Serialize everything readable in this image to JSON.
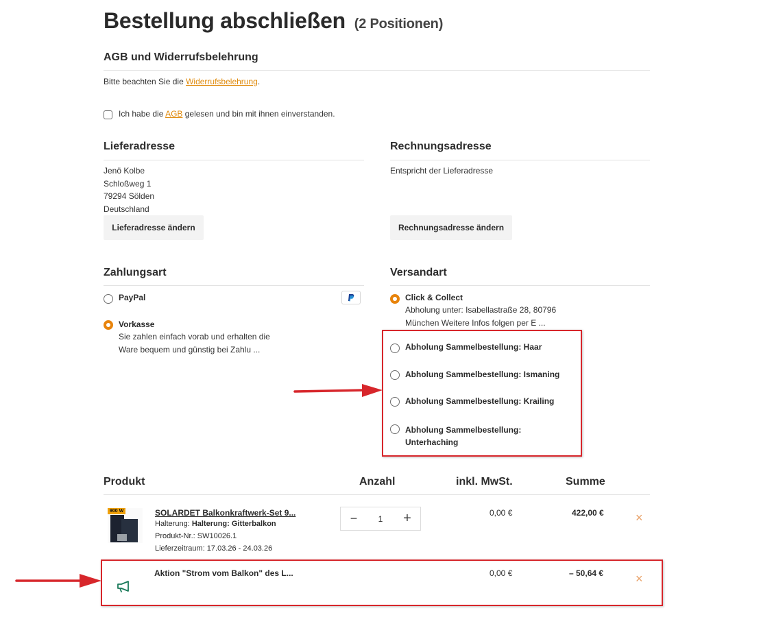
{
  "header": {
    "title": "Bestellung abschließen",
    "count": "(2 Positionen)"
  },
  "agb": {
    "heading": "AGB und Widerrufsbelehrung",
    "notice_prefix": "Bitte beachten Sie die ",
    "notice_link": "Widerrufsbelehrung",
    "notice_suffix": ".",
    "checkbox_prefix": "Ich habe die ",
    "checkbox_link": "AGB",
    "checkbox_suffix": " gelesen und bin mit ihnen einverstanden."
  },
  "delivery": {
    "heading": "Lieferadresse",
    "lines": [
      "Jenö Kolbe",
      "Schloßweg 1",
      "79294 Sölden",
      "Deutschland"
    ],
    "button": "Lieferadresse ändern"
  },
  "billing": {
    "heading": "Rechnungsadresse",
    "text": "Entspricht der Lieferadresse",
    "button": "Rechnungsadresse ändern"
  },
  "payment": {
    "heading": "Zahlungsart",
    "options": [
      {
        "label": "PayPal",
        "selected": false,
        "icon": "paypal-icon"
      },
      {
        "label": "Vorkasse",
        "selected": true,
        "desc": [
          "Sie zahlen einfach vorab und erhalten die",
          "Ware bequem und günstig bei Zahlu ..."
        ]
      }
    ]
  },
  "shipping": {
    "heading": "Versandart",
    "options": [
      {
        "label": "Click & Collect",
        "selected": true,
        "desc": [
          "Abholung unter: Isabellastraße 28, 80796",
          "München Weitere Infos folgen per E ..."
        ]
      },
      {
        "label": "Abholung Sammelbestellung: Haar",
        "selected": false
      },
      {
        "label": "Abholung Sammelbestellung: Ismaning",
        "selected": false
      },
      {
        "label": "Abholung Sammelbestellung: Krailing",
        "selected": false
      },
      {
        "label": "Abholung Sammelbestellung:",
        "label2": "Unterhaching",
        "selected": false
      }
    ]
  },
  "table": {
    "headers": {
      "product": "Produkt",
      "quantity": "Anzahl",
      "vat": "inkl. MwSt.",
      "sum": "Summe"
    },
    "items": [
      {
        "name": "SOLARDET Balkonkraftwerk-Set 9...",
        "badge": "900 W",
        "attr_label": "Halterung: ",
        "attr_value": "Halterung: Gitterbalkon",
        "sku": "Produkt-Nr.: SW10026.1",
        "delivery": "Lieferzeitraum: 17.03.26 - 24.03.26",
        "quantity": "1",
        "vat": "0,00 €",
        "sum": "422,00 €"
      },
      {
        "name": "Aktion \"Strom vom Balkon\" des L...",
        "icon": "megaphone-icon",
        "vat": "0,00 €",
        "sum": "– 50,64 €"
      }
    ],
    "remove_glyph": "×",
    "minus_glyph": "−",
    "plus_glyph": "+"
  },
  "colors": {
    "accent": "#e8840c",
    "link": "#e08a0b",
    "annotation": "#d7262b",
    "promo_icon": "#1a7a5a"
  }
}
